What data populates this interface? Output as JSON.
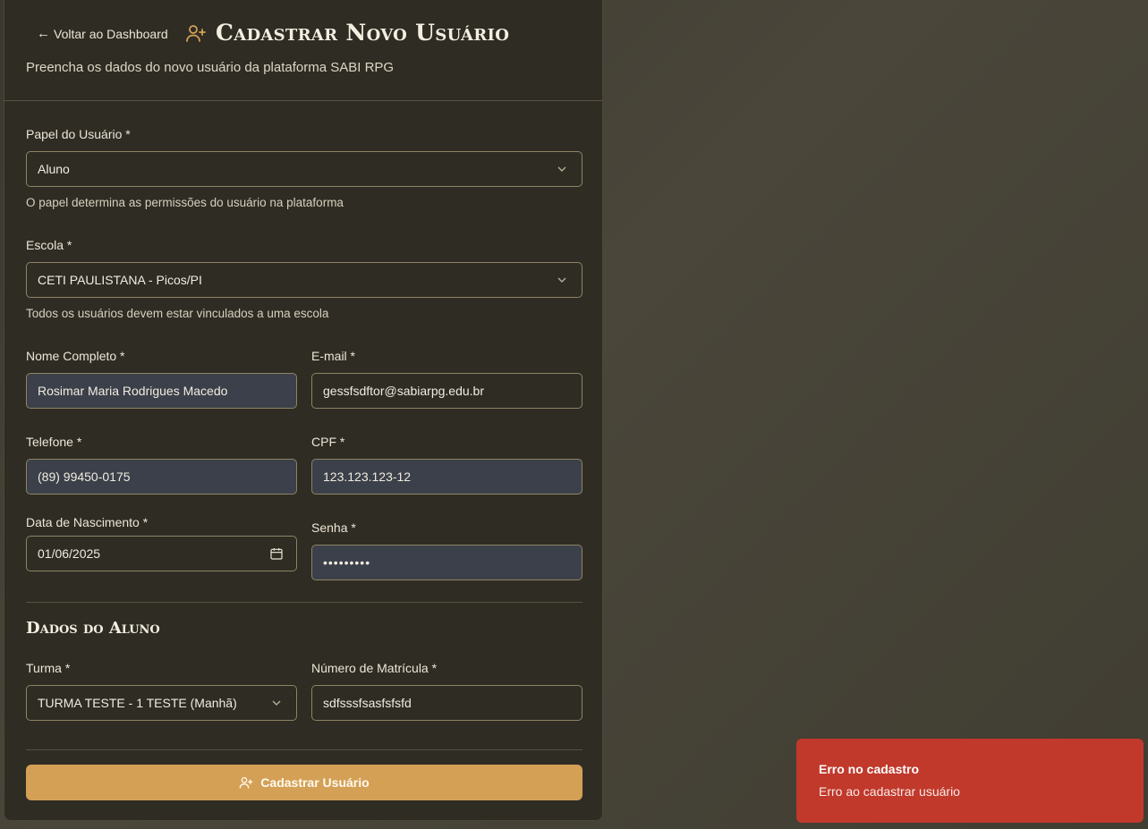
{
  "header": {
    "back_label": "Voltar ao Dashboard",
    "title": "Cadastrar Novo Usuário",
    "subtitle": "Preencha os dados do novo usuário da plataforma SABI RPG"
  },
  "form": {
    "role": {
      "label": "Papel do Usuário *",
      "value": "Aluno",
      "hint": "O papel determina as permissões do usuário na plataforma"
    },
    "school": {
      "label": "Escola *",
      "value": "CETI PAULISTANA - Picos/PI",
      "hint": "Todos os usuários devem estar vinculados a uma escola"
    },
    "name": {
      "label": "Nome Completo *",
      "value": "Rosimar Maria Rodrigues Macedo"
    },
    "email": {
      "label": "E-mail *",
      "value": "gessfsdftor@sabiarpg.edu.br"
    },
    "phone": {
      "label": "Telefone *",
      "value": "(89) 99450-0175"
    },
    "cpf": {
      "label": "CPF *",
      "value": "123.123.123-12"
    },
    "birth": {
      "label": "Data de Nascimento *",
      "value": "01/06/2025"
    },
    "password": {
      "label": "Senha *",
      "value": "•••••••••"
    }
  },
  "student": {
    "section_title": "Dados do Aluno",
    "class": {
      "label": "Turma *",
      "value": "TURMA TESTE - 1 TESTE (Manhã)"
    },
    "enrollment": {
      "label": "Número de Matrícula *",
      "value": "sdfsssfsasfsfsfd"
    }
  },
  "submit_label": "Cadastrar Usuário",
  "toast": {
    "title": "Erro no cadastro",
    "message": "Erro ao cadastrar usuário",
    "color": "#c0392b"
  },
  "colors": {
    "accent": "#d4a055",
    "panel": "#2f2c24"
  }
}
